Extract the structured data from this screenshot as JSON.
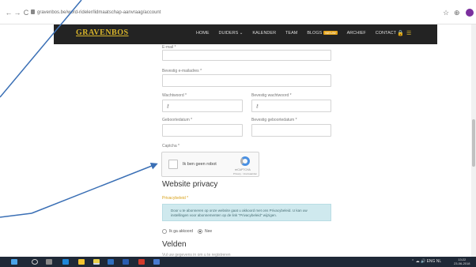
{
  "browser": {
    "url": "gravenbos.be/word-rideler/lidmaatschap-aanvraag/account",
    "back": "←",
    "forward": "→",
    "reload": "C",
    "star": "☆",
    "ext": "⊕"
  },
  "site": {
    "logo": "GRAVENBOS",
    "menu": [
      "HOME",
      "DUIDERS ⌄",
      "KALENDER",
      "TEAM",
      "BLOGS",
      "ARCHIEF",
      "CONTACT"
    ],
    "blog_badge": "NIEUW",
    "accent_color": "#e8c230"
  },
  "form": {
    "email_label": "E-mail *",
    "confirm_email_label": "Bevestig e-mailadres *",
    "password_label": "Wachtwoord *",
    "confirm_password_label": "Bevestig wachtwoord *",
    "birthdate_label": "Geboortedatum *",
    "confirm_birthdate_label": "Bevestig geboortedatum *",
    "captcha_label": "Captcha *",
    "captcha_text": "Ik ben geen robot",
    "recaptcha_brand": "reCAPTCHA",
    "recaptcha_links": "Privacy - Voorwaarden"
  },
  "privacy": {
    "title": "Website privacy",
    "label": "Privacybeleid *",
    "notice": "Door u te abonneren op onze website gaat u akkoord met ons Privacybeleid. U kan uw instellingen voor abonnementen op de link \"Privacybeleid\" wijzigen.",
    "option_yes": "Ik ga akkoord",
    "option_no": "Nee"
  },
  "fields": {
    "title": "Velden",
    "subtitle": "Vul uw gegevens in om u te registreren"
  },
  "taskbar": {
    "tray_text": "⌃ ☁ 🔊 ENG NL",
    "time": "13:22",
    "date": "23-06-2018"
  }
}
